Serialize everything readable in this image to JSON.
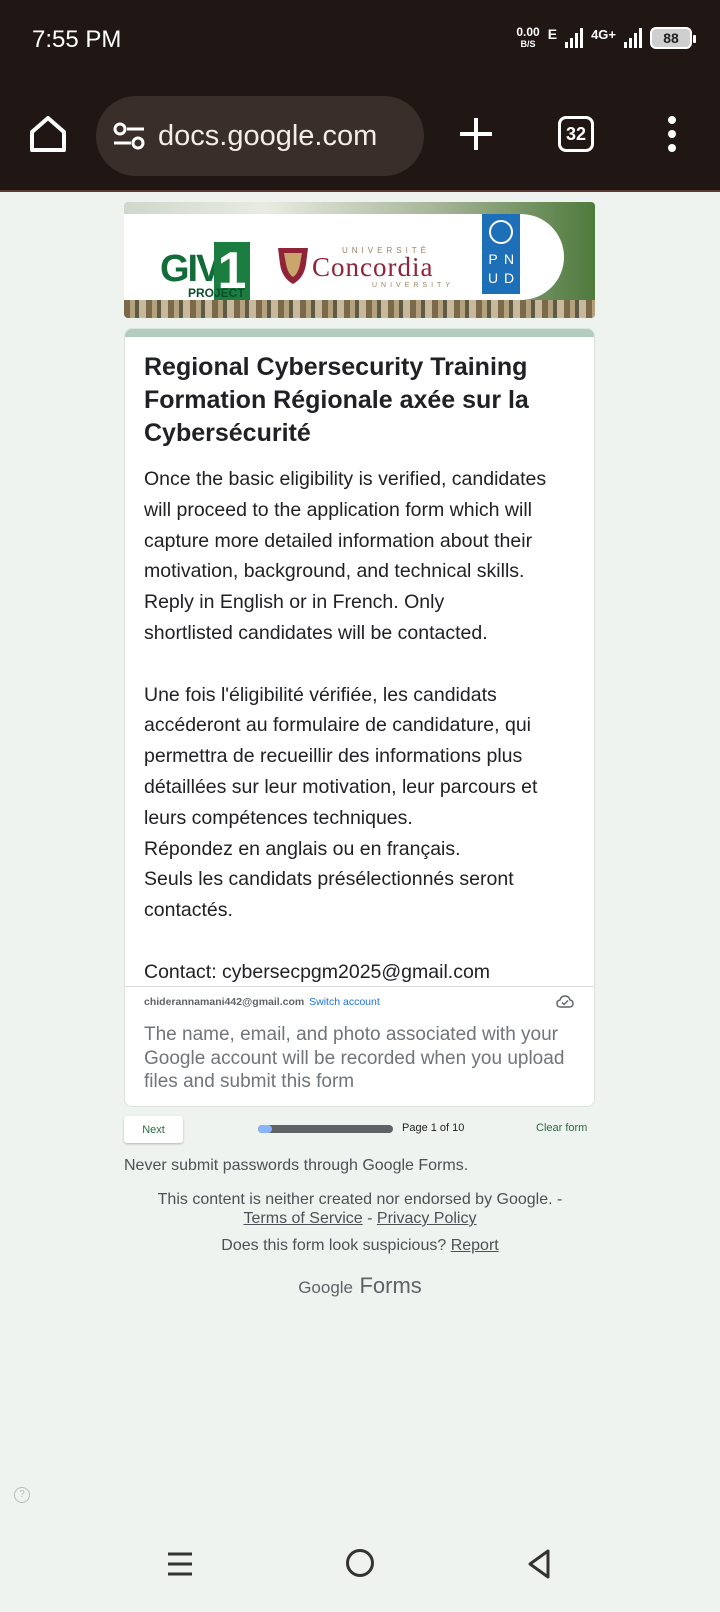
{
  "status_bar": {
    "time": "7:55 PM",
    "net_speed": "0.00",
    "net_speed_unit": "B/S",
    "net_type_1": "E",
    "net_type_2": "4G+",
    "battery": "88"
  },
  "browser": {
    "url": "docs.google.com",
    "tab_count": "32"
  },
  "banner": {
    "give_text": "GIVE",
    "give_one": "1",
    "give_project": "PROJECT",
    "concordia_top": "UNIVERSITÉ",
    "concordia_name": "Concordia",
    "concordia_bottom": "UNIVERSITY",
    "undp_letters": [
      "P",
      "N",
      "U",
      "D"
    ]
  },
  "form": {
    "title": "Regional Cybersecurity Training\nFormation Régionale axée sur la Cybersécurité",
    "description": "Once the basic eligibility is verified, candidates will proceed to the application form which will capture more detailed information about their motivation, background, and technical skills.\nReply in English or in French. Only\nshortlisted candidates will be contacted.\n\nUne fois l'éligibilité vérifiée, les candidats accéderont au formulaire de candidature, qui permettra de recueillir des informations plus détaillées sur leur motivation, leur parcours et leurs compétences techniques.\nRépondez en anglais ou en français.\nSeuls les candidats présélectionnés seront contactés.\n\nContact: cybersecpgm2025@gmail.com",
    "account_email": "chiderannamani442@gmail.com",
    "switch_account": "Switch account",
    "notice": "The name, email, and photo associated with your Google account will be recorded when you upload files and submit this form"
  },
  "navigation": {
    "next_label": "Next",
    "page_indicator": "Page 1 of 10",
    "progress_fraction": 0.1,
    "clear_form": "Clear form"
  },
  "footer": {
    "never_submit": "Never submit passwords through Google Forms.",
    "disclaimer": "This content is neither created nor endorsed by Google. -",
    "terms": "Terms of Service",
    "separator": "-",
    "privacy": "Privacy Policy",
    "suspicious": "Does this form look suspicious?",
    "report": "Report",
    "brand_google": "Google",
    "brand_forms": "Forms"
  },
  "icons": {
    "home": "home-icon",
    "site_settings": "tune-icon",
    "new_tab": "plus-icon",
    "tabs": "tab-switcher-icon",
    "menu": "more-vert-icon",
    "cloud": "cloud-done-icon",
    "help": "help-icon",
    "recent": "recent-apps-icon",
    "nav_home": "circle-home-icon",
    "back": "back-triangle-icon"
  }
}
